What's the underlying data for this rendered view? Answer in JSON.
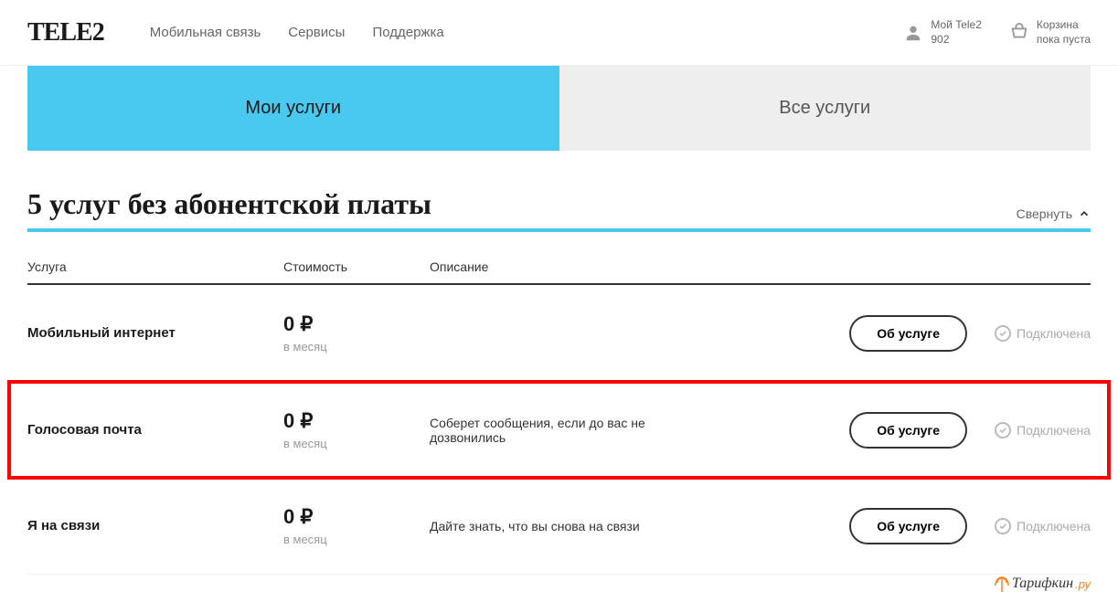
{
  "header": {
    "logo": "TELE2",
    "nav": [
      "Мобильная связь",
      "Сервисы",
      "Поддержка"
    ],
    "account": {
      "line1": "Мой Tele2",
      "line2": "902"
    },
    "cart": {
      "line1": "Корзина",
      "line2": "пока пуста"
    }
  },
  "tabs": {
    "active": "Мои услуги",
    "inactive": "Все услуги"
  },
  "section": {
    "title": "5 услуг без абонентской платы",
    "collapse": "Свернуть"
  },
  "columns": {
    "service": "Услуга",
    "cost": "Стоимость",
    "desc": "Описание"
  },
  "common": {
    "about": "Об услуге",
    "connected": "Подключена",
    "period": "в месяц",
    "price": "0 ₽"
  },
  "rows": [
    {
      "name": "Мобильный интернет",
      "desc": ""
    },
    {
      "name": "Голосовая почта",
      "desc": "Соберет сообщения, если до вас не дозвонились",
      "highlighted": true
    },
    {
      "name": "Я на связи",
      "desc": "Дайте знать, что вы снова на связи"
    }
  ],
  "watermark": {
    "text": "Тарифкин",
    "suffix": ".ру"
  }
}
